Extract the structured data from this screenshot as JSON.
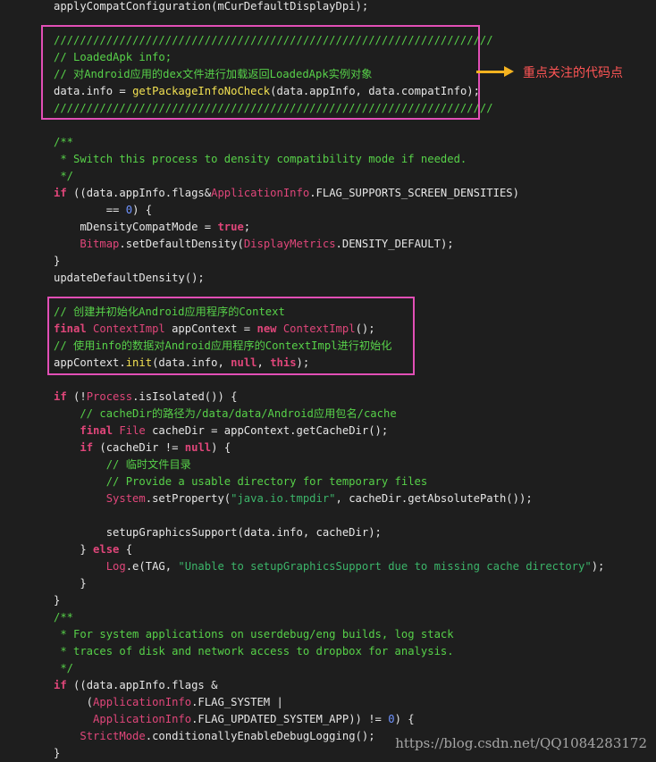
{
  "code_lines": [
    [
      [
        "applyCompatConfiguration(mCurDefaultDisplayDpi);",
        "plain"
      ]
    ],
    [],
    [
      [
        "///////////////////////////////////////////////////////////////////",
        "comment"
      ]
    ],
    [
      [
        "// LoadedApk info;",
        "comment"
      ]
    ],
    [
      [
        "// 对Android应用的dex文件进行加载返回LoadedApk实例对象",
        "comment"
      ]
    ],
    [
      [
        "data.info = ",
        "plain"
      ],
      [
        "getPackageInfoNoCheck",
        "fn"
      ],
      [
        "(data.appInfo, data.compatInfo);",
        "plain"
      ]
    ],
    [
      [
        "///////////////////////////////////////////////////////////////////",
        "comment"
      ]
    ],
    [],
    [
      [
        "/**",
        "doc"
      ]
    ],
    [
      [
        " * Switch this process to density compatibility mode if needed.",
        "doc"
      ]
    ],
    [
      [
        " */",
        "doc"
      ]
    ],
    [
      [
        "if",
        "kw"
      ],
      [
        " ((data.appInfo.flags&",
        "plain"
      ],
      [
        "ApplicationInfo",
        "type"
      ],
      [
        ".FLAG_SUPPORTS_SCREEN_DENSITIES)",
        "plain"
      ]
    ],
    [
      [
        "        == ",
        "plain"
      ],
      [
        "0",
        "num"
      ],
      [
        ") {",
        "plain"
      ]
    ],
    [
      [
        "    mDensityCompatMode = ",
        "plain"
      ],
      [
        "true",
        "kw"
      ],
      [
        ";",
        "plain"
      ]
    ],
    [
      [
        "    ",
        "plain"
      ],
      [
        "Bitmap",
        "type"
      ],
      [
        ".setDefaultDensity(",
        "plain"
      ],
      [
        "DisplayMetrics",
        "type"
      ],
      [
        ".DENSITY_DEFAULT);",
        "plain"
      ]
    ],
    [
      [
        "}",
        "plain"
      ]
    ],
    [
      [
        "updateDefaultDensity();",
        "plain"
      ]
    ],
    [],
    [
      [
        "// 创建并初始化Android应用程序的Context",
        "comment"
      ]
    ],
    [
      [
        "final",
        "kw"
      ],
      [
        " ",
        "plain"
      ],
      [
        "ContextImpl",
        "type"
      ],
      [
        " appContext = ",
        "plain"
      ],
      [
        "new",
        "kw"
      ],
      [
        " ",
        "plain"
      ],
      [
        "ContextImpl",
        "type"
      ],
      [
        "();",
        "plain"
      ]
    ],
    [
      [
        "// 使用info的数据对Android应用程序的ContextImpl进行初始化",
        "comment"
      ]
    ],
    [
      [
        "appContext.",
        "plain"
      ],
      [
        "init",
        "fn"
      ],
      [
        "(data.info, ",
        "plain"
      ],
      [
        "null",
        "kw"
      ],
      [
        ", ",
        "plain"
      ],
      [
        "this",
        "kw"
      ],
      [
        ");",
        "plain"
      ]
    ],
    [],
    [
      [
        "if",
        "kw"
      ],
      [
        " (!",
        "plain"
      ],
      [
        "Process",
        "type"
      ],
      [
        ".isIsolated()) {",
        "plain"
      ]
    ],
    [
      [
        "    // cacheDir的路径为/data/data/Android应用包名/cache",
        "comment"
      ]
    ],
    [
      [
        "    ",
        "plain"
      ],
      [
        "final",
        "kw"
      ],
      [
        " ",
        "plain"
      ],
      [
        "File",
        "type"
      ],
      [
        " cacheDir = appContext.getCacheDir();",
        "plain"
      ]
    ],
    [
      [
        "    ",
        "plain"
      ],
      [
        "if",
        "kw"
      ],
      [
        " (cacheDir != ",
        "plain"
      ],
      [
        "null",
        "kw"
      ],
      [
        ") {",
        "plain"
      ]
    ],
    [
      [
        "        // 临时文件目录",
        "comment"
      ]
    ],
    [
      [
        "        // Provide a usable directory for temporary files",
        "comment"
      ]
    ],
    [
      [
        "        ",
        "plain"
      ],
      [
        "System",
        "type"
      ],
      [
        ".setProperty(",
        "plain"
      ],
      [
        "\"java.io.tmpdir\"",
        "str"
      ],
      [
        ", cacheDir.getAbsolutePath());",
        "plain"
      ]
    ],
    [],
    [
      [
        "        setupGraphicsSupport(data.info, cacheDir);",
        "plain"
      ]
    ],
    [
      [
        "    } ",
        "plain"
      ],
      [
        "else",
        "kw"
      ],
      [
        " {",
        "plain"
      ]
    ],
    [
      [
        "        ",
        "plain"
      ],
      [
        "Log",
        "type"
      ],
      [
        ".e(TAG, ",
        "plain"
      ],
      [
        "\"Unable to setupGraphicsSupport due to missing cache directory\"",
        "str"
      ],
      [
        ");",
        "plain"
      ]
    ],
    [
      [
        "    }",
        "plain"
      ]
    ],
    [
      [
        "}",
        "plain"
      ]
    ],
    [
      [
        "/**",
        "doc"
      ]
    ],
    [
      [
        " * For system applications on userdebug/eng builds, log stack",
        "doc"
      ]
    ],
    [
      [
        " * traces of disk and network access to dropbox for analysis.",
        "doc"
      ]
    ],
    [
      [
        " */",
        "doc"
      ]
    ],
    [
      [
        "if",
        "kw"
      ],
      [
        " ((data.appInfo.flags &",
        "plain"
      ]
    ],
    [
      [
        "     (",
        "plain"
      ],
      [
        "ApplicationInfo",
        "type"
      ],
      [
        ".FLAG_SYSTEM |",
        "plain"
      ]
    ],
    [
      [
        "      ",
        "plain"
      ],
      [
        "ApplicationInfo",
        "type"
      ],
      [
        ".FLAG_UPDATED_SYSTEM_APP)) != ",
        "plain"
      ],
      [
        "0",
        "num"
      ],
      [
        ") {",
        "plain"
      ]
    ],
    [
      [
        "    ",
        "plain"
      ],
      [
        "StrictMode",
        "type"
      ],
      [
        ".conditionallyEnableDebugLogging();",
        "plain"
      ]
    ],
    [
      [
        "}",
        "plain"
      ]
    ]
  ],
  "annotation": {
    "label": "重点关注的代码点"
  },
  "watermark": {
    "text": "https://blog.csdn.net/QQ1084283172"
  },
  "colors": {
    "background": "#1e1e1e",
    "comment": "#57d149",
    "keyword": "#e0467a",
    "function": "#f2e152",
    "number": "#6f93ff",
    "string": "#3cb56a",
    "highlight_box": "#e24fb6",
    "arrow": "#f5b320",
    "annotation_text": "#ff5555"
  }
}
